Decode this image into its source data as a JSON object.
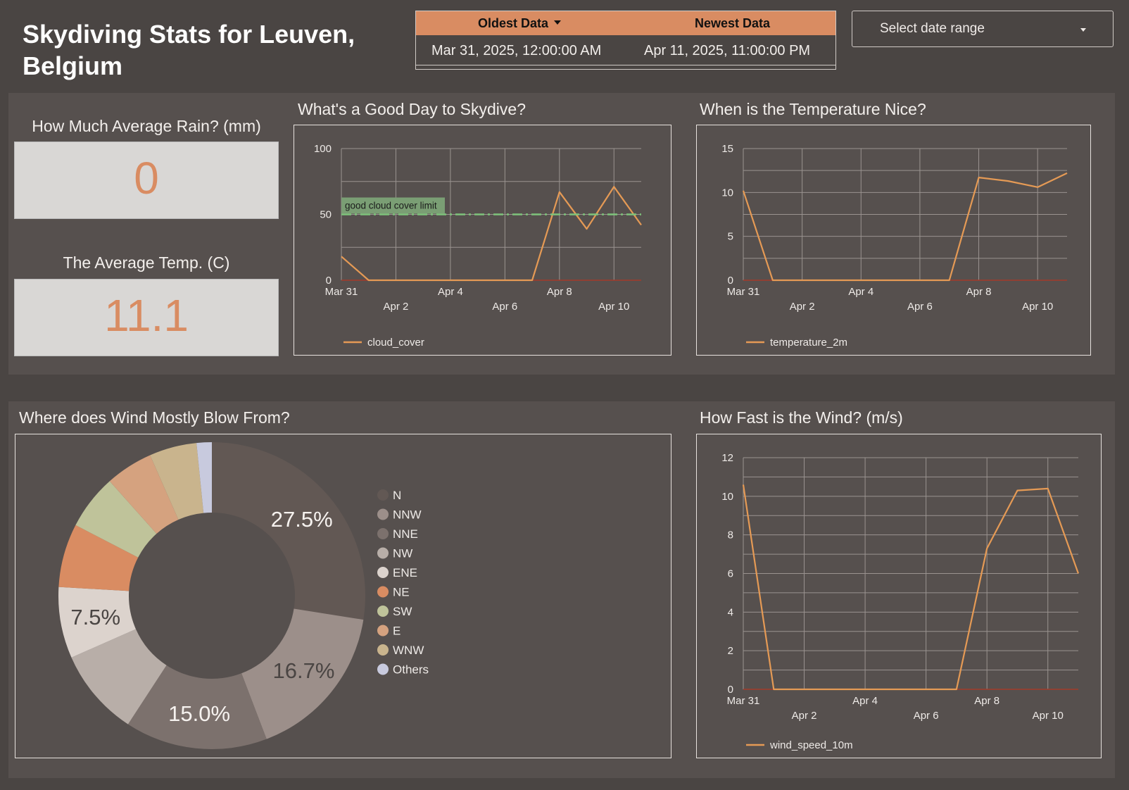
{
  "header": {
    "title": "Skydiving Stats for Leuven, Belgium"
  },
  "data_range": {
    "oldest_label": "Oldest Data",
    "newest_label": "Newest Data",
    "oldest_value": "Mar 31, 2025, 12:00:00 AM",
    "newest_value": "Apr 11, 2025, 11:00:00 PM"
  },
  "date_picker": {
    "label": "Select date range"
  },
  "scorecards": {
    "rain": {
      "title": "How Much Average Rain? (mm)",
      "value": "0"
    },
    "temp": {
      "title": "The Average Temp. (C)",
      "value": "11.1"
    }
  },
  "colors": {
    "accent": "#d98c62",
    "line": "#e59a55",
    "threshold": "#7ec47b",
    "zero_line": "#a33a2a"
  },
  "chart_data": [
    {
      "type": "line",
      "title": "What's a Good Day to Skydive?",
      "x_ticks": [
        "Mar 31",
        "Apr 2",
        "Apr 4",
        "Apr 6",
        "Apr 8",
        "Apr 10"
      ],
      "x": [
        "Mar 31",
        "Apr 1",
        "Apr 2",
        "Apr 3",
        "Apr 4",
        "Apr 5",
        "Apr 6",
        "Apr 7",
        "Apr 8",
        "Apr 9",
        "Apr 10",
        "Apr 11"
      ],
      "y_ticks": [
        0,
        50,
        100
      ],
      "ylim": [
        0,
        100
      ],
      "grid": true,
      "series": [
        {
          "name": "cloud_cover",
          "values": [
            18,
            0,
            0,
            0,
            0,
            0,
            0,
            0,
            67,
            39,
            71,
            42
          ]
        }
      ],
      "reference_line": {
        "label": "good cloud cover limit",
        "value": 50
      },
      "legend": "bottom-left"
    },
    {
      "type": "line",
      "title": "When is the Temperature Nice?",
      "x_ticks": [
        "Mar 31",
        "Apr 2",
        "Apr 4",
        "Apr 6",
        "Apr 8",
        "Apr 10"
      ],
      "x": [
        "Mar 31",
        "Apr 1",
        "Apr 2",
        "Apr 3",
        "Apr 4",
        "Apr 5",
        "Apr 6",
        "Apr 7",
        "Apr 8",
        "Apr 9",
        "Apr 10",
        "Apr 11"
      ],
      "y_ticks": [
        0,
        5,
        10,
        15
      ],
      "ylim": [
        0,
        15
      ],
      "grid": true,
      "series": [
        {
          "name": "temperature_2m",
          "values": [
            10.2,
            0,
            0,
            0,
            0,
            0,
            0,
            0,
            11.7,
            11.3,
            10.6,
            12.2
          ]
        }
      ],
      "legend": "bottom-left"
    },
    {
      "type": "pie",
      "title": "Where does Wind Mostly Blow From?",
      "donut": true,
      "slices": [
        {
          "label": "N",
          "value": 27.5,
          "color": "#625854"
        },
        {
          "label": "NNW",
          "value": 16.7,
          "color": "#9c8f8a"
        },
        {
          "label": "NNE",
          "value": 15.0,
          "color": "#7c716d"
        },
        {
          "label": "NW",
          "value": 9.2,
          "color": "#b8aea8"
        },
        {
          "label": "ENE",
          "value": 7.5,
          "color": "#dcd3cd"
        },
        {
          "label": "NE",
          "value": 6.7,
          "color": "#d98c62"
        },
        {
          "label": "SW",
          "value": 5.8,
          "color": "#bfc39a"
        },
        {
          "label": "E",
          "value": 5.0,
          "color": "#d5a27f"
        },
        {
          "label": "WNW",
          "value": 5.0,
          "color": "#c9b48d"
        },
        {
          "label": "Others",
          "value": 1.6,
          "color": "#c8cade"
        }
      ],
      "visible_labels": [
        "27.5%",
        "16.7%",
        "15.0%",
        "7.5%"
      ],
      "legend": "right"
    },
    {
      "type": "line",
      "title": "How Fast is the Wind? (m/s)",
      "x_ticks": [
        "Mar 31",
        "Apr 2",
        "Apr 4",
        "Apr 6",
        "Apr 8",
        "Apr 10"
      ],
      "x": [
        "Mar 31",
        "Apr 1",
        "Apr 2",
        "Apr 3",
        "Apr 4",
        "Apr 5",
        "Apr 6",
        "Apr 7",
        "Apr 8",
        "Apr 9",
        "Apr 10",
        "Apr 11"
      ],
      "y_ticks": [
        0,
        2,
        4,
        6,
        8,
        10,
        12
      ],
      "ylim": [
        0,
        12
      ],
      "grid": true,
      "series": [
        {
          "name": "wind_speed_10m",
          "values": [
            10.6,
            0,
            0,
            0,
            0,
            0,
            0,
            0,
            7.3,
            10.3,
            10.4,
            6.0
          ]
        }
      ],
      "legend": "bottom-left"
    }
  ]
}
